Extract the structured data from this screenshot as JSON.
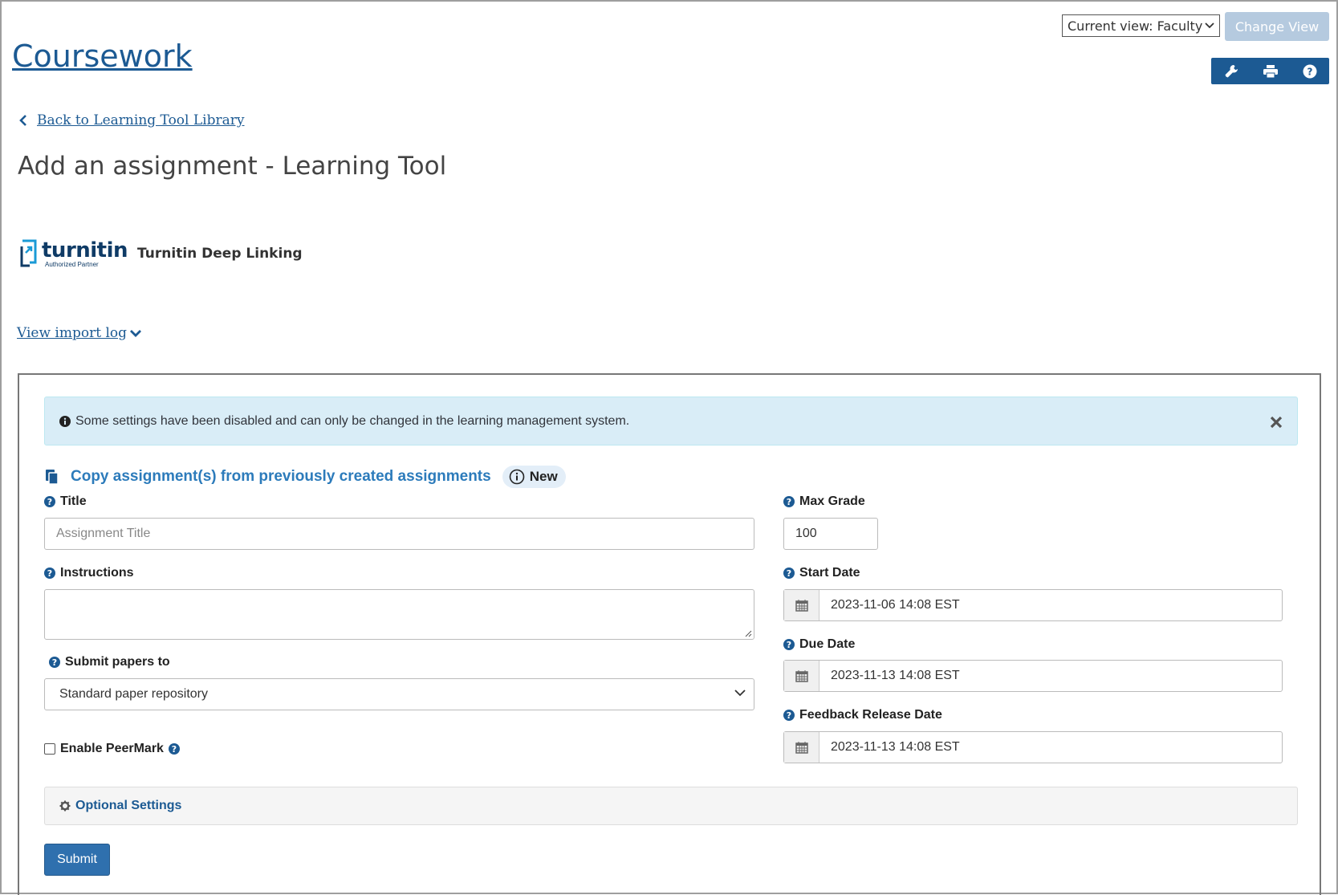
{
  "header": {
    "view_select_value": "Current view: Faculty",
    "change_view_label": "Change View",
    "site_title": "Coursework",
    "tools": [
      "wrench-icon",
      "print-icon",
      "help-icon"
    ]
  },
  "nav": {
    "back_label": "Back to Learning Tool Library"
  },
  "page": {
    "title": "Add an assignment - Learning Tool",
    "tool_logo_word": "turnitin",
    "tool_logo_sub": "Authorized Partner",
    "tool_name": "Turnitin Deep Linking",
    "import_log_label": "View import log"
  },
  "alert": {
    "message": "Some settings have been disabled and can only be changed in the learning management system."
  },
  "copy": {
    "label": "Copy assignment(s) from previously created assignments",
    "badge": "New"
  },
  "form": {
    "title_label": "Title",
    "title_placeholder": "Assignment Title",
    "instructions_label": "Instructions",
    "submit_to_label": "Submit papers to",
    "submit_to_value": "Standard paper repository",
    "peermark_label": "Enable PeerMark",
    "max_grade_label": "Max Grade",
    "max_grade_value": "100",
    "start_date_label": "Start Date",
    "start_date_value": "2023-11-06 14:08 EST",
    "due_date_label": "Due Date",
    "due_date_value": "2023-11-13 14:08 EST",
    "feedback_label": "Feedback Release Date",
    "feedback_value": "2023-11-13 14:08 EST",
    "optional_label": "Optional Settings",
    "submit_label": "Submit"
  },
  "colors": {
    "brand": "#1c5a93",
    "link": "#2c7bbb",
    "alert_bg": "#d9edf7",
    "submit_bg": "#2f70ae"
  }
}
